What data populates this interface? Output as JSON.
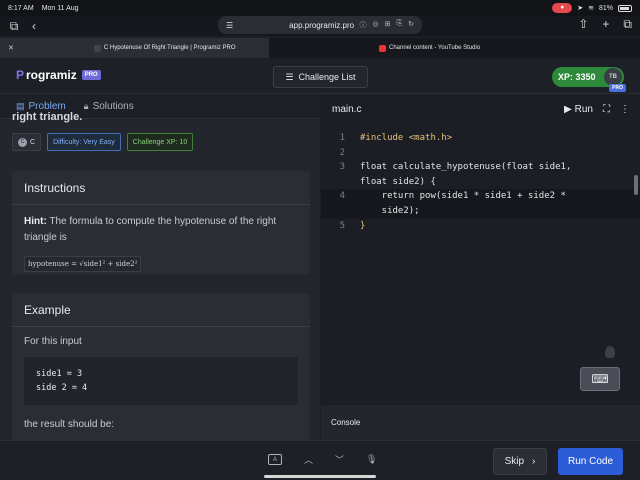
{
  "status_bar": {
    "time": "8:17 AM",
    "date": "Mon 11 Aug",
    "battery": "81%"
  },
  "browser": {
    "url": "app.programiz.pro",
    "tabs": [
      {
        "label": "C Hypotenuse Of Right Triangle | Programiz PRO",
        "active": true
      },
      {
        "label": "Channel content - YouTube Studio",
        "active": false
      }
    ]
  },
  "header": {
    "logo_text": "rogramiz",
    "logo_p": "P",
    "logo_badge": "PRO",
    "challenge_list": "Challenge List",
    "xp": "XP: 3350",
    "avatar_text": "TB",
    "pro_badge": "PRO"
  },
  "panel_tabs": {
    "problem": "Problem",
    "solutions": "Solutions"
  },
  "problem": {
    "truncated_heading": "right triangle.",
    "tags": {
      "language": "C",
      "difficulty": "Difficulty: Very Easy",
      "xp": "Challenge XP: 10"
    },
    "instructions_title": "Instructions",
    "hint_label": "Hint:",
    "hint_text": " The formula to compute the hypotenuse of the right triangle is",
    "formula": "hypotenuse = √side1² + side2²",
    "example_title": "Example",
    "example_sub": "For this input",
    "example_input": [
      "side1 = 3",
      "side 2 = 4"
    ],
    "result_text": "the result should be:"
  },
  "editor": {
    "filename": "main.c",
    "run_label": "Run",
    "lines": [
      {
        "n": "1",
        "text": "#include <math.h>"
      },
      {
        "n": "2",
        "text": ""
      },
      {
        "n": "3",
        "text": "float calculate_hypotenuse(float side1,"
      },
      {
        "n": "",
        "text": "float side2) {"
      },
      {
        "n": "4",
        "text": "    return pow(side1 * side1 + side2 *"
      },
      {
        "n": "",
        "text": "    side2);"
      },
      {
        "n": "5",
        "text": "}"
      }
    ]
  },
  "console": {
    "title": "Console"
  },
  "bottom": {
    "skip": "Skip",
    "run_code": "Run Code"
  }
}
